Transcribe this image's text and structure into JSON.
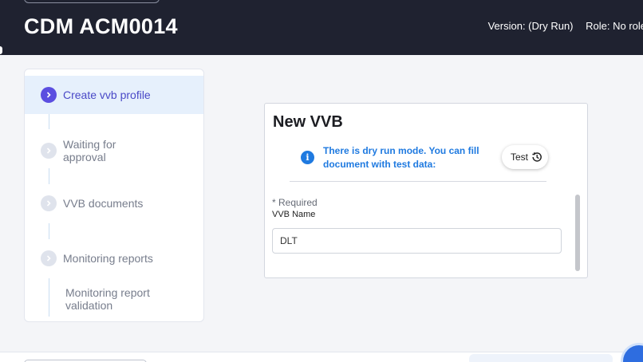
{
  "header": {
    "title": "CDM ACM0014",
    "version": "Version: (Dry Run)",
    "role": "Role: No role"
  },
  "stepper": {
    "steps": [
      {
        "label": "Create vvb profile",
        "state": "active"
      },
      {
        "label": "Waiting for approval",
        "state": "pending"
      },
      {
        "label": "VVB documents",
        "state": "pending"
      },
      {
        "label": "Monitoring reports",
        "state": "pending"
      },
      {
        "label": "Monitoring report validation",
        "state": "pending"
      }
    ]
  },
  "form": {
    "title": "New VVB",
    "info_text": "There is dry run mode. You can fill document with test data:",
    "test_button": "Test",
    "required_note": "* Required",
    "field_label": "VVB Name",
    "field_value": "DLT"
  },
  "colors": {
    "header_bg": "#1f2230",
    "accent": "#5b4ee0",
    "info_blue": "#1f7ae0",
    "active_step_bg": "#e6f0fc"
  },
  "icons": {
    "step_active": "chevron-right-icon",
    "step_pending": "chevron-right-icon",
    "info": "info-icon",
    "test": "history-icon"
  }
}
